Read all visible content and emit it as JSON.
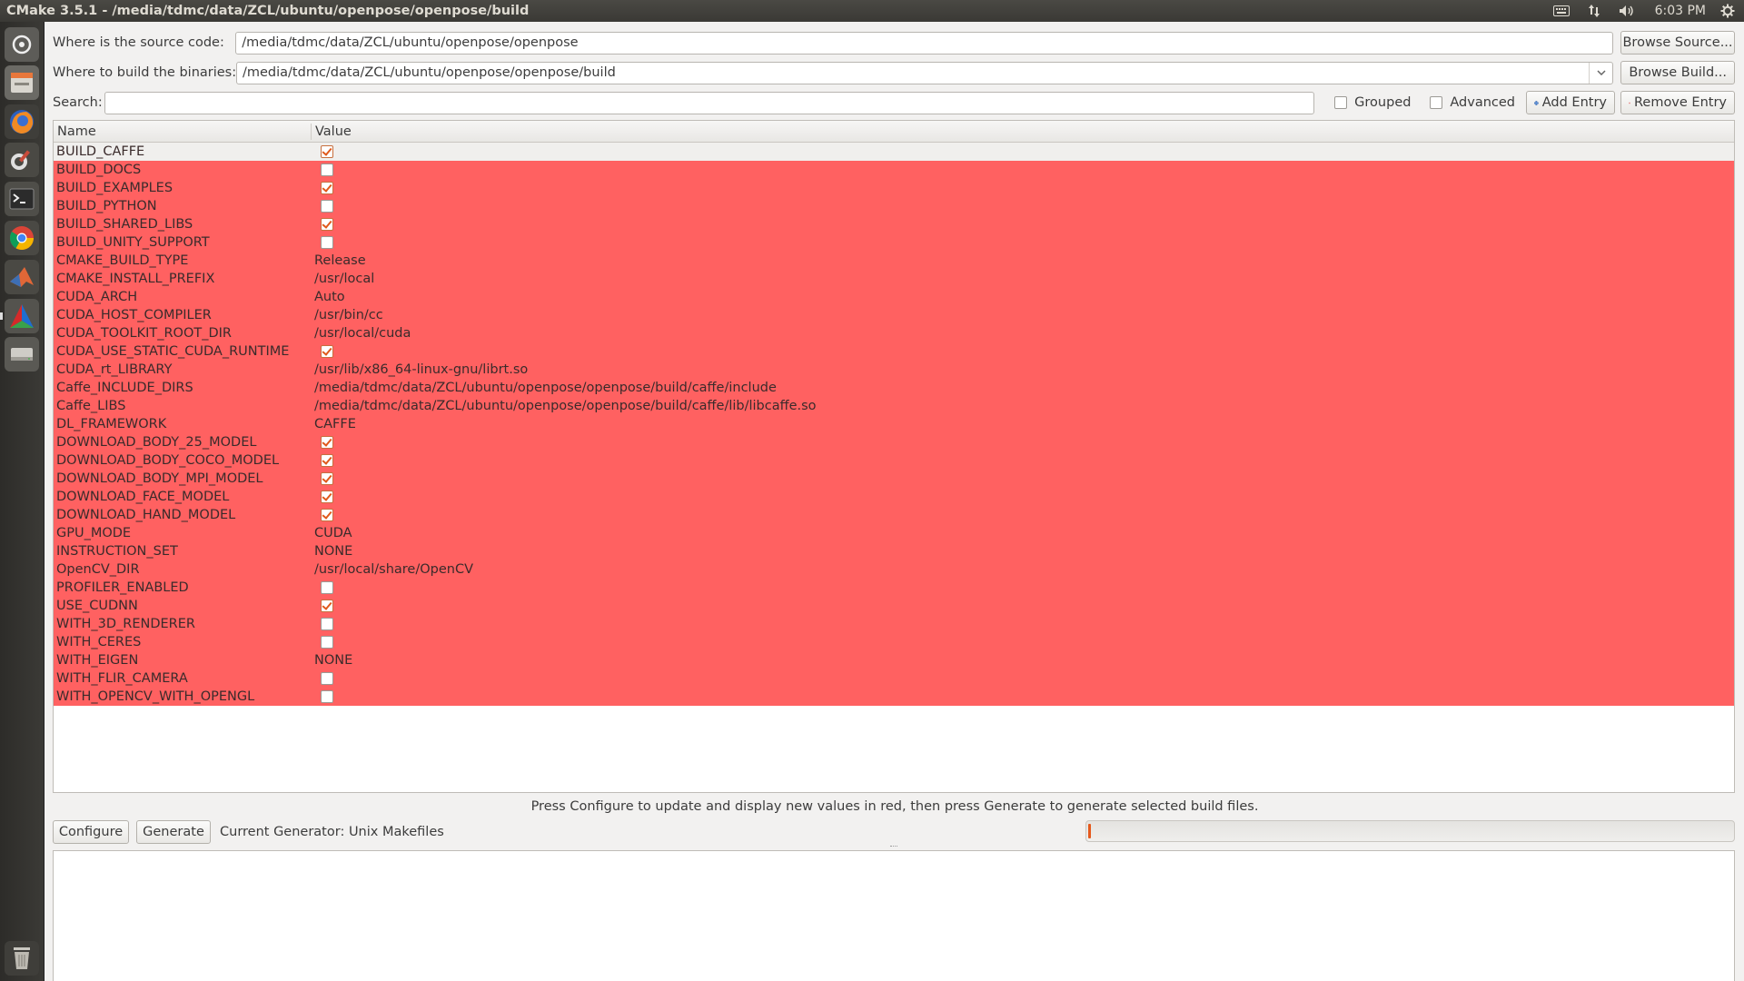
{
  "window_title": "CMake 3.5.1 - /media/tdmc/data/ZCL/ubuntu/openpose/openpose/build",
  "tray": {
    "clock": "6:03 PM"
  },
  "source": {
    "label": "Where is the source code:",
    "value": "/media/tdmc/data/ZCL/ubuntu/openpose/openpose",
    "browse_label": "Browse Source..."
  },
  "build": {
    "label": "Where to build the binaries:",
    "value": "/media/tdmc/data/ZCL/ubuntu/openpose/openpose/build",
    "browse_label": "Browse Build..."
  },
  "search": {
    "label": "Search:",
    "value": "",
    "grouped_label": "Grouped",
    "advanced_label": "Advanced",
    "add_entry_label": "Add Entry",
    "remove_entry_label": "Remove Entry"
  },
  "table": {
    "columns": [
      "Name",
      "Value"
    ],
    "rows": [
      {
        "name": "BUILD_CAFFE",
        "type": "bool",
        "checked": true,
        "value": ""
      },
      {
        "name": "BUILD_DOCS",
        "type": "bool",
        "checked": false,
        "value": ""
      },
      {
        "name": "BUILD_EXAMPLES",
        "type": "bool",
        "checked": true,
        "value": ""
      },
      {
        "name": "BUILD_PYTHON",
        "type": "bool",
        "checked": false,
        "value": ""
      },
      {
        "name": "BUILD_SHARED_LIBS",
        "type": "bool",
        "checked": true,
        "value": ""
      },
      {
        "name": "BUILD_UNITY_SUPPORT",
        "type": "bool",
        "checked": false,
        "value": ""
      },
      {
        "name": "CMAKE_BUILD_TYPE",
        "type": "text",
        "value": "Release"
      },
      {
        "name": "CMAKE_INSTALL_PREFIX",
        "type": "text",
        "value": "/usr/local"
      },
      {
        "name": "CUDA_ARCH",
        "type": "text",
        "value": "Auto"
      },
      {
        "name": "CUDA_HOST_COMPILER",
        "type": "text",
        "value": "/usr/bin/cc"
      },
      {
        "name": "CUDA_TOOLKIT_ROOT_DIR",
        "type": "text",
        "value": "/usr/local/cuda"
      },
      {
        "name": "CUDA_USE_STATIC_CUDA_RUNTIME",
        "type": "bool",
        "checked": true,
        "value": ""
      },
      {
        "name": "CUDA_rt_LIBRARY",
        "type": "text",
        "value": "/usr/lib/x86_64-linux-gnu/librt.so"
      },
      {
        "name": "Caffe_INCLUDE_DIRS",
        "type": "text",
        "value": "/media/tdmc/data/ZCL/ubuntu/openpose/openpose/build/caffe/include"
      },
      {
        "name": "Caffe_LIBS",
        "type": "text",
        "value": "/media/tdmc/data/ZCL/ubuntu/openpose/openpose/build/caffe/lib/libcaffe.so"
      },
      {
        "name": "DL_FRAMEWORK",
        "type": "text",
        "value": "CAFFE"
      },
      {
        "name": "DOWNLOAD_BODY_25_MODEL",
        "type": "bool",
        "checked": true,
        "value": ""
      },
      {
        "name": "DOWNLOAD_BODY_COCO_MODEL",
        "type": "bool",
        "checked": true,
        "value": ""
      },
      {
        "name": "DOWNLOAD_BODY_MPI_MODEL",
        "type": "bool",
        "checked": true,
        "value": ""
      },
      {
        "name": "DOWNLOAD_FACE_MODEL",
        "type": "bool",
        "checked": true,
        "value": ""
      },
      {
        "name": "DOWNLOAD_HAND_MODEL",
        "type": "bool",
        "checked": true,
        "value": ""
      },
      {
        "name": "GPU_MODE",
        "type": "text",
        "value": "CUDA"
      },
      {
        "name": "INSTRUCTION_SET",
        "type": "text",
        "value": "NONE"
      },
      {
        "name": "OpenCV_DIR",
        "type": "text",
        "value": "/usr/local/share/OpenCV"
      },
      {
        "name": "PROFILER_ENABLED",
        "type": "bool",
        "checked": false,
        "value": ""
      },
      {
        "name": "USE_CUDNN",
        "type": "bool",
        "checked": true,
        "value": ""
      },
      {
        "name": "WITH_3D_RENDERER",
        "type": "bool",
        "checked": false,
        "value": ""
      },
      {
        "name": "WITH_CERES",
        "type": "bool",
        "checked": false,
        "value": ""
      },
      {
        "name": "WITH_EIGEN",
        "type": "text",
        "value": "NONE"
      },
      {
        "name": "WITH_FLIR_CAMERA",
        "type": "bool",
        "checked": false,
        "value": ""
      },
      {
        "name": "WITH_OPENCV_WITH_OPENGL",
        "type": "bool",
        "checked": false,
        "value": ""
      }
    ],
    "selected_row": 0,
    "highlight_color": "#ff6161"
  },
  "hint": "Press Configure to update and display new values in red, then press Generate to generate selected build files.",
  "bottom": {
    "configure_label": "Configure",
    "generate_label": "Generate",
    "generator_text": "Current Generator: Unix Makefiles",
    "progress_fraction": 0.003
  },
  "accent_color": "#e5591c",
  "launcher_icons": [
    "dash-icon",
    "files-icon",
    "firefox-icon",
    "system-settings-icon",
    "terminal-icon",
    "chrome-icon",
    "matlab-icon",
    "cmake-icon",
    "disk-icon",
    "trash-icon"
  ]
}
